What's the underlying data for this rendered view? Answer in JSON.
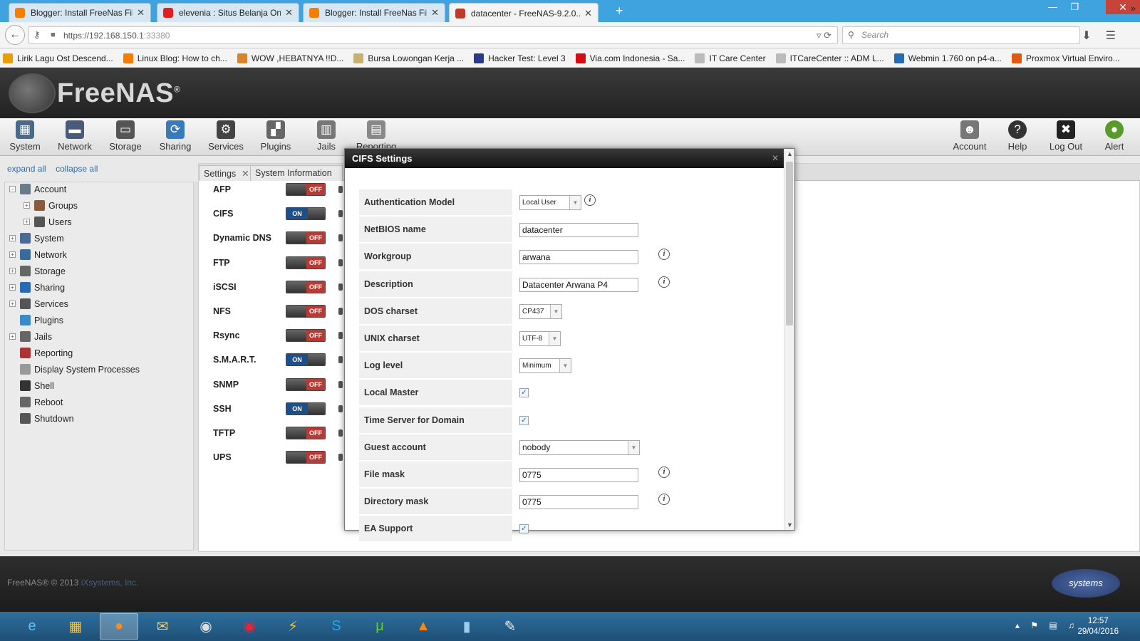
{
  "browser": {
    "tabs": [
      {
        "title": "Blogger: Install FreeNas Fil...",
        "color": "#f57d00"
      },
      {
        "title": "elevenia : Situs Belanja Onli...",
        "color": "#e02020"
      },
      {
        "title": "Blogger: Install FreeNas Fil...",
        "color": "#f57d00"
      },
      {
        "title": "datacenter - FreeNAS-9.2.0...",
        "color": "#c0392b"
      }
    ],
    "url": "https://192.168.150.1:33380",
    "url_host": "https://192.168.150.1",
    "url_port": ":33380",
    "search_placeholder": "Search",
    "bookmarks": [
      {
        "label": "Lirik Lagu Ost Descend...",
        "color": "#e8a000"
      },
      {
        "label": "Linux Blog: How to ch...",
        "color": "#f57d00"
      },
      {
        "label": "WOW ,HEBATNYA !!D...",
        "color": "#d8842a"
      },
      {
        "label": "Bursa Lowongan Kerja ...",
        "color": "#c8b070"
      },
      {
        "label": "Hacker Test: Level 3",
        "color": "#2a3a8a"
      },
      {
        "label": "Via.com Indonesia - Sa...",
        "color": "#d01010"
      },
      {
        "label": "IT Care Center",
        "color": "#bbbbbb"
      },
      {
        "label": "ITCareCenter :: ADM L...",
        "color": "#bbbbbb"
      },
      {
        "label": "Webmin 1.760 on p4-a...",
        "color": "#2a6ab0"
      },
      {
        "label": "Proxmox Virtual Enviro...",
        "color": "#e05a10"
      }
    ]
  },
  "app": {
    "logo": "FreeNAS",
    "toolbar_left": [
      "System",
      "Network",
      "Storage",
      "Sharing",
      "Services",
      "Plugins",
      "Jails",
      "Reporting"
    ],
    "toolbar_right": [
      "Account",
      "Help",
      "Log Out",
      "Alert"
    ],
    "tree_links": {
      "expand": "expand all",
      "collapse": "collapse all"
    },
    "tree": [
      {
        "label": "Account",
        "level": 0,
        "expander": "−"
      },
      {
        "label": "Groups",
        "level": 1,
        "expander": "+"
      },
      {
        "label": "Users",
        "level": 1,
        "expander": "+"
      },
      {
        "label": "System",
        "level": 0,
        "expander": "+"
      },
      {
        "label": "Network",
        "level": 0,
        "expander": "+"
      },
      {
        "label": "Storage",
        "level": 0,
        "expander": "+"
      },
      {
        "label": "Sharing",
        "level": 0,
        "expander": "+"
      },
      {
        "label": "Services",
        "level": 0,
        "expander": "+"
      },
      {
        "label": "Plugins",
        "level": 0,
        "expander": ""
      },
      {
        "label": "Jails",
        "level": 0,
        "expander": "+"
      },
      {
        "label": "Reporting",
        "level": 0,
        "expander": ""
      },
      {
        "label": "Display System Processes",
        "level": 0,
        "expander": ""
      },
      {
        "label": "Shell",
        "level": 0,
        "expander": ""
      },
      {
        "label": "Reboot",
        "level": 0,
        "expander": ""
      },
      {
        "label": "Shutdown",
        "level": 0,
        "expander": ""
      }
    ],
    "content_tabs": [
      "Settings",
      "System Information"
    ],
    "switch_on": "ON",
    "switch_off": "OFF",
    "services": [
      {
        "name": "AFP",
        "state": "off"
      },
      {
        "name": "CIFS",
        "state": "on"
      },
      {
        "name": "Dynamic DNS",
        "state": "off"
      },
      {
        "name": "FTP",
        "state": "off"
      },
      {
        "name": "iSCSI",
        "state": "off"
      },
      {
        "name": "NFS",
        "state": "off"
      },
      {
        "name": "Rsync",
        "state": "off"
      },
      {
        "name": "S.M.A.R.T.",
        "state": "on"
      },
      {
        "name": "SNMP",
        "state": "off"
      },
      {
        "name": "SSH",
        "state": "on"
      },
      {
        "name": "TFTP",
        "state": "off"
      },
      {
        "name": "UPS",
        "state": "off"
      }
    ],
    "footer": {
      "copyright": "FreeNAS® © 2013",
      "company": "iXsystems, Inc.",
      "partner_logo": "systems"
    }
  },
  "modal": {
    "title": "CIFS Settings",
    "fields": [
      {
        "label": "Authentication Model",
        "type": "select",
        "value": "Local User",
        "info": true
      },
      {
        "label": "NetBIOS name",
        "type": "text",
        "value": "datacenter",
        "info": false
      },
      {
        "label": "Workgroup",
        "type": "text",
        "value": "arwana",
        "info": true
      },
      {
        "label": "Description",
        "type": "text",
        "value": "Datacenter Arwana P4",
        "info": true
      },
      {
        "label": "DOS charset",
        "type": "select",
        "value": "CP437",
        "info": false
      },
      {
        "label": "UNIX charset",
        "type": "select",
        "value": "UTF-8",
        "info": false
      },
      {
        "label": "Log level",
        "type": "select",
        "value": "Minimum",
        "info": false
      },
      {
        "label": "Local Master",
        "type": "checkbox",
        "value": true,
        "info": false
      },
      {
        "label": "Time Server for Domain",
        "type": "checkbox",
        "value": true,
        "info": false
      },
      {
        "label": "Guest account",
        "type": "select-wide",
        "value": "nobody",
        "info": false
      },
      {
        "label": "File mask",
        "type": "text",
        "value": "0775",
        "info": true
      },
      {
        "label": "Directory mask",
        "type": "text",
        "value": "0775",
        "info": true
      },
      {
        "label": "EA Support",
        "type": "checkbox",
        "value": true,
        "info": false
      }
    ]
  },
  "taskbar": {
    "time": "12:57",
    "date": "29/04/2016"
  }
}
